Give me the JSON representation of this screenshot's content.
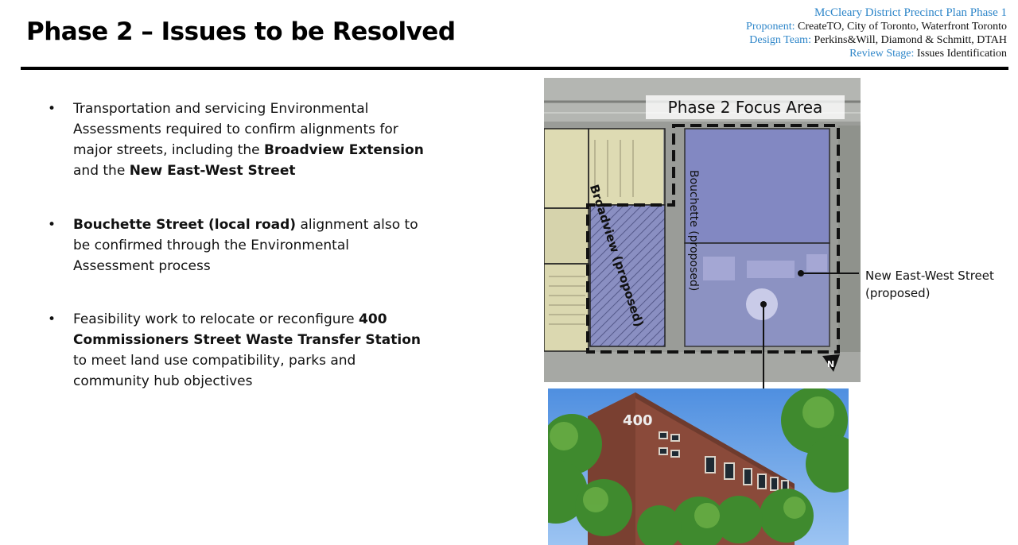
{
  "header": {
    "title": "Phase 2 – Issues to be Resolved",
    "plan": "McCleary District Precinct Plan Phase 1",
    "proponent_key": "Proponent:",
    "proponent_value": " CreateTO, City of Toronto, Waterfront Toronto",
    "design_key": "Design Team:",
    "design_value": " Perkins&Will, Diamond & Schmitt, DTAH",
    "stage_key": "Review Stage:",
    "stage_value": " Issues Identification"
  },
  "bullets": {
    "b1": {
      "text1": "Transportation and servicing Environmental Assessments required to confirm alignments for major streets, including the ",
      "bold1": "Broadview Extension",
      "text2": " and the ",
      "bold2": "New East-West Street"
    },
    "b2": {
      "bold1": "Bouchette Street (local road)",
      "text1": " alignment also to be confirmed through the Environmental Assessment process"
    },
    "b3": {
      "text1": "Feasibility work to relocate or reconfigure ",
      "bold1": "400 Commissioners Street Waste Transfer Station",
      "text2": " to meet land use compatibility, parks and community hub objectives"
    }
  },
  "map": {
    "focus_label": "Phase 2 Focus Area",
    "bouchette_label": "Bouchette  (proposed)",
    "broadview_label": "Broadview (proposed)",
    "north_label": "N",
    "new_street_label_line1": "New East-West Street",
    "new_street_label_line2": "(proposed)"
  },
  "photo": {
    "building_number": "400"
  },
  "colors": {
    "accent_blue": "#2e86c9",
    "focus_overlay": "#7f86c8",
    "parcel_overlay": "#e8e4b8"
  }
}
